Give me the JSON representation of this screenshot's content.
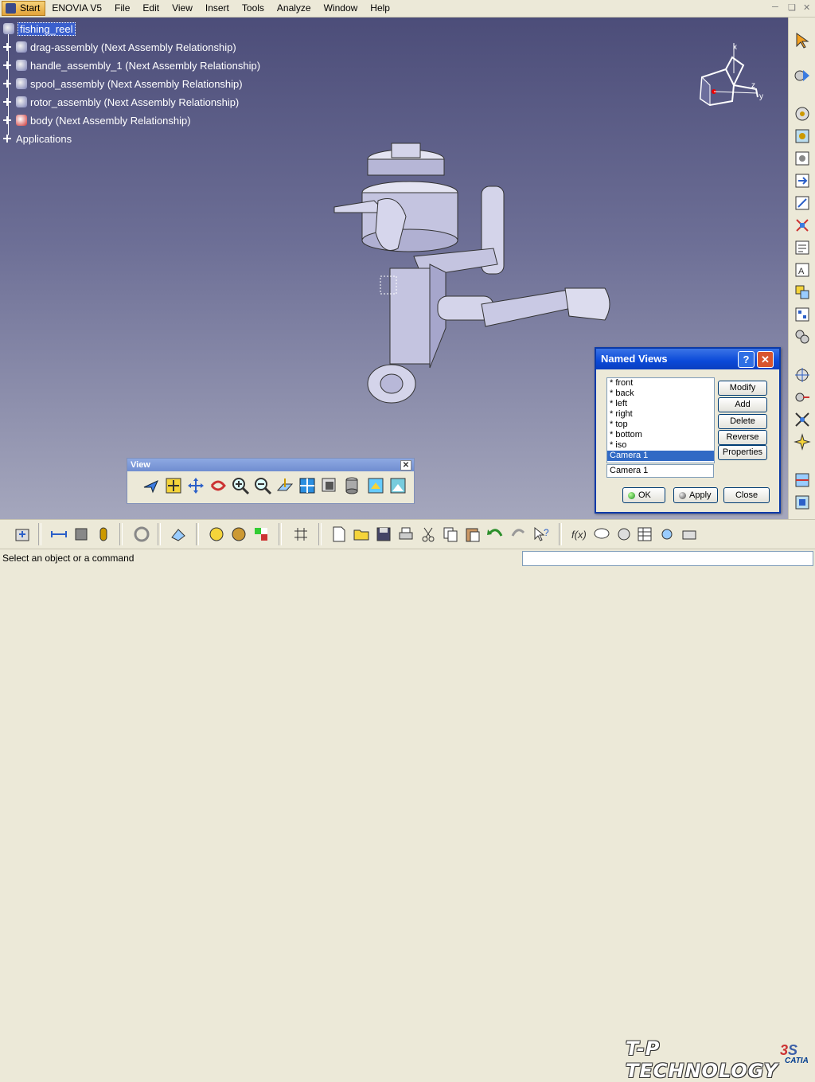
{
  "menubar": {
    "items": [
      "Start",
      "ENOVIA V5",
      "File",
      "Edit",
      "View",
      "Insert",
      "Tools",
      "Analyze",
      "Window",
      "Help"
    ]
  },
  "tree": {
    "root": "fishing_reel",
    "children": [
      "drag-assembly (Next Assembly Relationship)",
      "handle_assembly_1 (Next Assembly Relationship)",
      "spool_assembly (Next Assembly Relationship)",
      "rotor_assembly (Next Assembly Relationship)",
      "body (Next Assembly Relationship)",
      "Applications"
    ]
  },
  "compass": {
    "axis_x": "x",
    "axis_y": "y",
    "axis_z": "z"
  },
  "named_views": {
    "title": "Named Views",
    "help": "?",
    "close": "✕",
    "views": [
      "* front",
      "* back",
      "* left",
      "* right",
      "* top",
      "* bottom",
      "* iso",
      "Camera   1"
    ],
    "selected_index": 7,
    "name_value": "Camera   1",
    "buttons": {
      "modify": "Modify",
      "add": "Add",
      "delete": "Delete",
      "reverse": "Reverse",
      "properties": "Properties"
    },
    "ok": "OK",
    "apply": "Apply",
    "close_label": "Close"
  },
  "view_toolbar": {
    "title": "View",
    "close": "✕",
    "icons": [
      "fly-mode-icon",
      "fit-all-icon",
      "pan-icon",
      "rotate-icon",
      "zoom-in-icon",
      "zoom-out-icon",
      "normal-view-icon",
      "multi-view-icon",
      "quick-view-icon",
      "render-style-icon",
      "named-views-icon",
      "hide-show-icon"
    ]
  },
  "watermark": "T-P TECHNOLOGY",
  "catia_logo": "CATIA",
  "status": {
    "message": "Select an object or a command",
    "command_input": ""
  },
  "colors": {
    "accent": "#0a49d8",
    "viewport_top": "#4c4d79",
    "viewport_bottom": "#a5a7bd",
    "selection": "#316ac5"
  }
}
